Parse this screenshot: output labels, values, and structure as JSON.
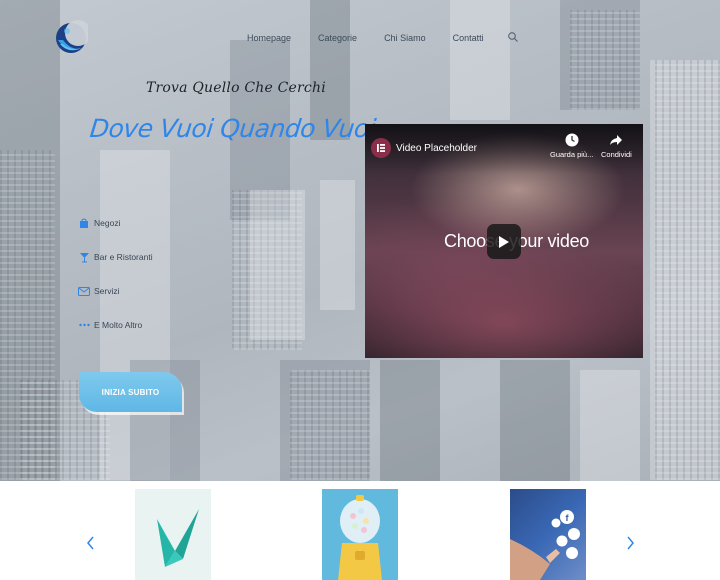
{
  "nav": {
    "items": [
      {
        "label": "Homepage"
      },
      {
        "label": "Categorie"
      },
      {
        "label": "Chi Siamo"
      },
      {
        "label": "Contatti"
      }
    ]
  },
  "hero": {
    "tagline": "Trova Quello Che Cerchi",
    "headline": "Dove Vuoi Quando Vuoi",
    "features": [
      {
        "label": "Negozi",
        "icon": "shopping-bag-icon"
      },
      {
        "label": "Bar e Ristoranti",
        "icon": "cocktail-icon"
      },
      {
        "label": "Servizi",
        "icon": "envelope-icon"
      },
      {
        "label": "E Molto Altro",
        "icon": "ellipsis-icon"
      }
    ],
    "cta_label": "INIZIA SUBITO"
  },
  "video": {
    "title": "Video Placeholder",
    "watch_later_label": "Guarda più...",
    "share_label": "Condividi",
    "center_text": "Choose your video"
  },
  "colors": {
    "headline": "#2f86e8",
    "cta": "#6cc0ea",
    "icons": "#2f86e8"
  }
}
